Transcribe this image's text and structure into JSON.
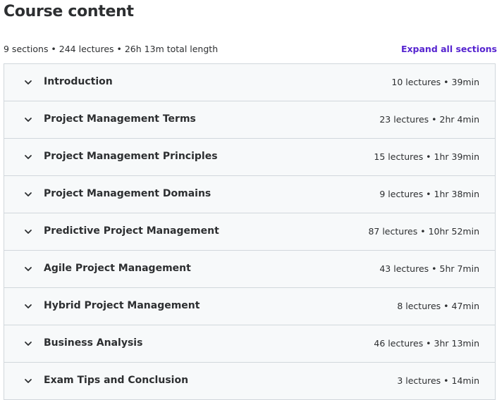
{
  "header": {
    "title": "Course content",
    "summary": "9 sections • 244 lectures • 26h 13m total length",
    "expand_label": "Expand all sections"
  },
  "colors": {
    "accent": "#5624d0",
    "text": "#2d2f31",
    "section_bg": "#f7f9fa",
    "border": "#d1d7dc"
  },
  "sections": [
    {
      "title": "Introduction",
      "meta": "10 lectures • 39min",
      "icon": "chevron-down-icon"
    },
    {
      "title": "Project Management Terms",
      "meta": "23 lectures • 2hr 4min",
      "icon": "chevron-down-icon"
    },
    {
      "title": "Project Management Principles",
      "meta": "15 lectures • 1hr 39min",
      "icon": "chevron-down-icon"
    },
    {
      "title": "Project Management Domains",
      "meta": "9 lectures • 1hr 38min",
      "icon": "chevron-down-icon"
    },
    {
      "title": "Predictive Project Management",
      "meta": "87 lectures • 10hr 52min",
      "icon": "chevron-down-icon"
    },
    {
      "title": "Agile Project Management",
      "meta": "43 lectures • 5hr 7min",
      "icon": "chevron-down-icon"
    },
    {
      "title": "Hybrid Project Management",
      "meta": "8 lectures • 47min",
      "icon": "chevron-down-icon"
    },
    {
      "title": "Business Analysis",
      "meta": "46 lectures • 3hr 13min",
      "icon": "chevron-down-icon"
    },
    {
      "title": "Exam Tips and Conclusion",
      "meta": "3 lectures • 14min",
      "icon": "chevron-down-icon"
    }
  ]
}
